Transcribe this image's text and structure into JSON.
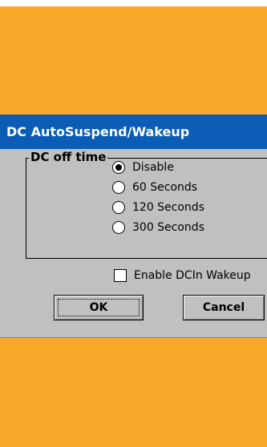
{
  "dialog": {
    "title": "DC AutoSuspend/Wakeup",
    "group_label": "DC off time",
    "options": [
      {
        "label": "Disable",
        "checked": true
      },
      {
        "label": "60 Seconds",
        "checked": false
      },
      {
        "label": "120 Seconds",
        "checked": false
      },
      {
        "label": "300 Seconds",
        "checked": false
      }
    ],
    "checkbox_label": "Enable DCIn Wakeup",
    "checkbox_checked": false,
    "ok_label": "OK",
    "cancel_label": "Cancel"
  },
  "colors": {
    "background": "#F7A82B",
    "titlebar": "#0A5CB4",
    "dialog_face": "#C0C0C0"
  }
}
